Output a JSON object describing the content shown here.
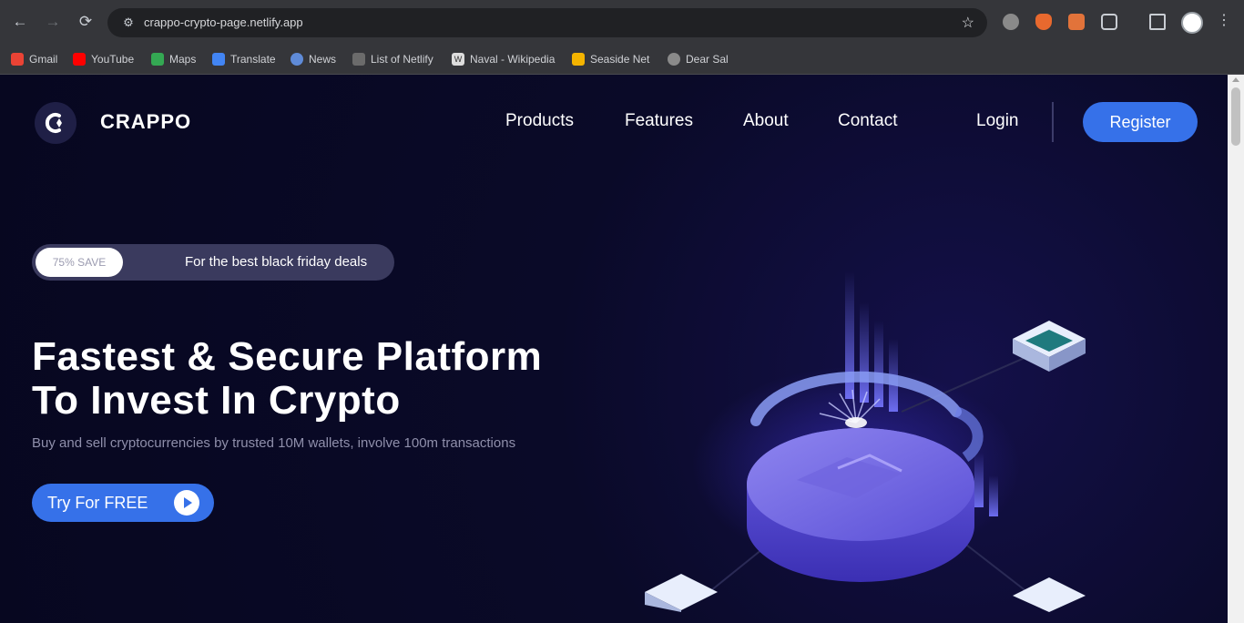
{
  "browser": {
    "url": "crappo-crypto-page.netlify.app",
    "bookmarks": [
      {
        "label": "Gmail",
        "color": "#ea4335"
      },
      {
        "label": "YouTube",
        "color": "#ff0000"
      },
      {
        "label": "Maps",
        "color": "#34a853"
      },
      {
        "label": "Translate",
        "color": "#4285f4"
      },
      {
        "label": "News",
        "color": "#5f8bd8"
      },
      {
        "label": "List of Netlify",
        "color": "#6b6b6b"
      },
      {
        "label": "Naval - Wikipedia",
        "color": "#dddddd"
      },
      {
        "label": "Seaside Net",
        "color": "#f4b400"
      },
      {
        "label": "Dear Sal",
        "color": "#8a8a8a"
      }
    ],
    "icons": {
      "back": "←",
      "forward": "→",
      "reload": "⟳",
      "site_info": "⚙",
      "bookmark_star": "☆",
      "menu": "⋮"
    }
  },
  "header": {
    "brand": "CRAPPO",
    "nav": [
      "Products",
      "Features",
      "About",
      "Contact"
    ],
    "login": "Login",
    "register": "Register"
  },
  "hero": {
    "promo_badge": "75% SAVE",
    "promo_text": "For the best black friday deals",
    "title_line1": "Fastest & Secure Platform",
    "title_line2": "To Invest In Crypto",
    "subtitle": "Buy and sell cryptocurrencies by trusted 10M wallets, involve 100m transactions",
    "cta": "Try For FREE"
  },
  "colors": {
    "page_bg": "#0a0a26",
    "accent": "#3671e9",
    "chrome": "#35363a"
  }
}
